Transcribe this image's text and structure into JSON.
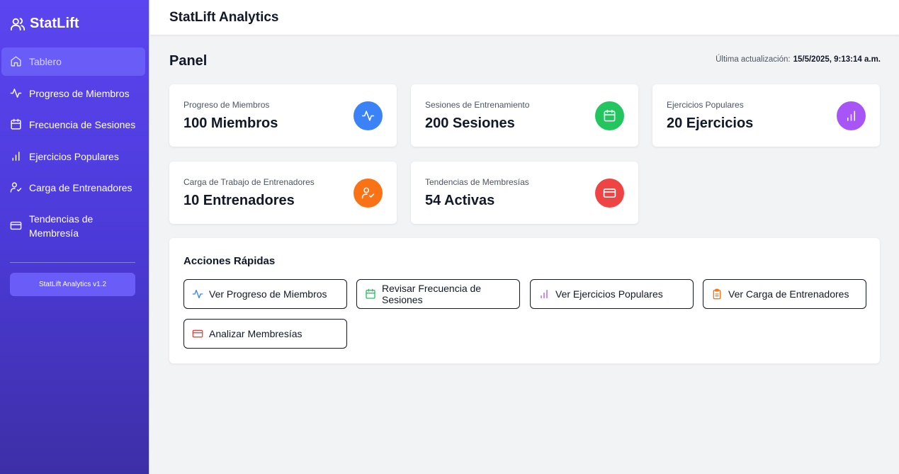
{
  "sidebar": {
    "brand": "StatLift",
    "items": [
      {
        "label": "Tablero",
        "icon": "home-icon",
        "active": true
      },
      {
        "label": "Progreso de Miembros",
        "icon": "activity-icon"
      },
      {
        "label": "Frecuencia de Sesiones",
        "icon": "calendar-icon"
      },
      {
        "label": "Ejercicios Populares",
        "icon": "bar-chart-icon"
      },
      {
        "label": "Carga de Entrenadores",
        "icon": "user-check-icon"
      },
      {
        "label": "Tendencias de Membresía",
        "icon": "credit-card-icon"
      }
    ],
    "version": "StatLift Analytics v1.2"
  },
  "header": {
    "title": "StatLift Analytics"
  },
  "main": {
    "title": "Panel",
    "updated_label": "Última actualización:",
    "updated_value": "15/5/2025, 9:13:14 a.m.",
    "cards": [
      {
        "title": "Progreso de Miembros",
        "value": "100 Miembros",
        "icon": "activity-icon",
        "color": "#3b82f6"
      },
      {
        "title": "Sesiones de Entrenamiento",
        "value": "200 Sesiones",
        "icon": "calendar-icon",
        "color": "#22c55e"
      },
      {
        "title": "Ejercicios Populares",
        "value": "20 Ejercicios",
        "icon": "bar-chart-icon",
        "color": "#a855f7"
      },
      {
        "title": "Carga de Trabajo de Entrenadores",
        "value": "10 Entrenadores",
        "icon": "user-check-icon",
        "color": "#f97316"
      },
      {
        "title": "Tendencias de Membresías",
        "value": "54 Activas",
        "icon": "credit-card-icon",
        "color": "#ef4444"
      }
    ],
    "quick_actions": {
      "title": "Acciones Rápidas",
      "buttons": [
        {
          "label": "Ver Progreso de Miembros",
          "icon": "activity-icon",
          "color": "#3b82f6"
        },
        {
          "label": "Revisar Frecuencia de Sesiones",
          "icon": "calendar-icon",
          "color": "#22c55e"
        },
        {
          "label": "Ver Ejercicios Populares",
          "icon": "bar-chart-icon",
          "color": "#a855f7"
        },
        {
          "label": "Ver Carga de Entrenadores",
          "icon": "clipboard-icon",
          "color": "#f97316"
        },
        {
          "label": "Analizar Membresías",
          "icon": "credit-card-icon",
          "color": "#ef4444"
        }
      ]
    }
  }
}
